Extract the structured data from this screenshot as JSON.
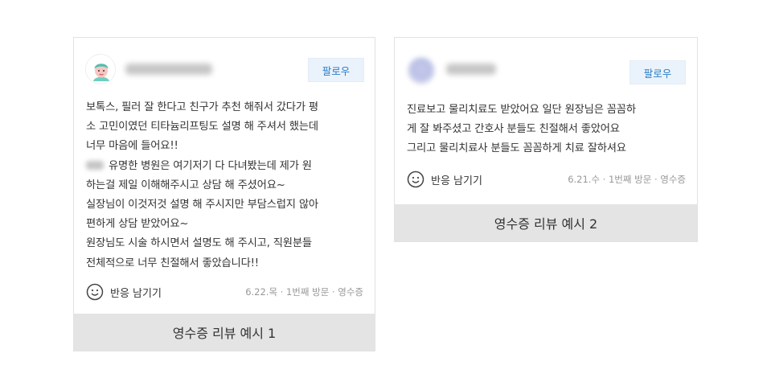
{
  "colors": {
    "follow_text": "#2b7cc7",
    "follow_bg": "#eaf3fb",
    "caption_bg": "#e4e4e4",
    "meta_text": "#999999"
  },
  "cards": [
    {
      "follow_label": "팔로우",
      "lines": [
        "보톡스, 필러 잘 한다고 친구가 추천 해줘서 갔다가 평",
        "소 고민이였던 티타늄리프팅도 설명 해 주셔서 했는데",
        "너무 마음에 들어요!!",
        "유명한 병원은 여기저기 다 다녀봤는데 제가 원",
        "하는걸 제일 이해해주시고 상담 해 주셨어요~",
        "실장님이 이것저것 설명 해 주시지만 부담스럽지 않아",
        "편하게 상담 받았어요~",
        "원장님도 시술 하시면서 설명도 해 주시고, 직원분들",
        "전체적으로 너무 친절해서 좋았습니다!!"
      ],
      "react_label": "반응 남기기",
      "react_icon": "smiley-icon",
      "meta": "6.22.목 · 1번째 방문 · 영수증",
      "caption": "영수증 리뷰 예시 1"
    },
    {
      "follow_label": "팔로우",
      "lines": [
        "진료보고 물리치료도 받았어요 일단 원장님은 꼼꼼하",
        "게 잘 봐주셨고 간호사 분들도 친절해서 좋았어요",
        "그리고 물리치료사 분들도 꼼꼼하게 치료 잘하셔요"
      ],
      "react_label": "반응 남기기",
      "react_icon": "smiley-icon",
      "meta": "6.21.수 · 1번째 방문 · 영수증",
      "caption": "영수증 리뷰 예시 2"
    }
  ]
}
